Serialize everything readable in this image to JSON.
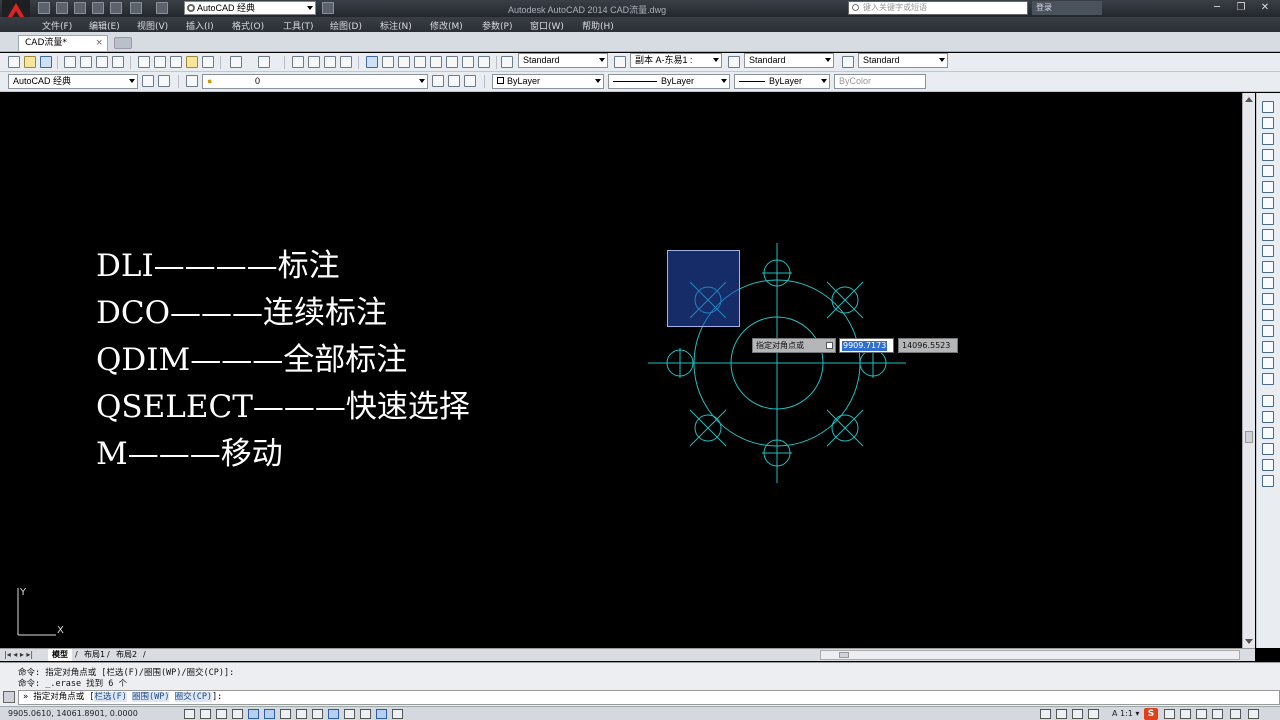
{
  "titlebar": {
    "app_title": "Autodesk AutoCAD 2014    CAD流量.dwg",
    "workspace": "AutoCAD 经典",
    "search_placeholder": "键入关键字或短语",
    "login_label": "登录",
    "minimize": "─",
    "restore": "❐",
    "close": "✕"
  },
  "menu": [
    "文件(F)",
    "编辑(E)",
    "视图(V)",
    "插入(I)",
    "格式(O)",
    "工具(T)",
    "绘图(D)",
    "标注(N)",
    "修改(M)",
    "参数(P)",
    "窗口(W)",
    "帮助(H)"
  ],
  "doc_tab": {
    "label": "CAD流量*",
    "close": "×"
  },
  "toolbar1": {
    "text_style": "Standard",
    "dim_style": "副本 A-东易1 :",
    "table_style": "Standard",
    "mleader_style": "Standard"
  },
  "toolbar2": {
    "workspace": "AutoCAD 经典",
    "layer": "0",
    "color": "ByLayer",
    "linetype": "ByLayer",
    "lineweight": "ByLayer",
    "plotstyle": "ByColor"
  },
  "canvas_text": [
    "DLI————标注",
    "DCO———连续标注",
    "QDIM———全部标注",
    "QSELECT———快速选择",
    "M———移动"
  ],
  "dynamic_input": {
    "prompt": "指定对角点或",
    "x_value": "9909.7173",
    "y_value": "14096.5523"
  },
  "ucs": {
    "x_label": "X",
    "y_label": "Y"
  },
  "layout_tabs": [
    "模型",
    "布局1",
    "布局2"
  ],
  "layout_tab_separator": "/",
  "layout_nav": "|◂ ◂ ▸ ▸|",
  "command": {
    "history": [
      "命令: 指定对角点或 [栏选(F)/圈围(WP)/圈交(CP)]:",
      "命令: _.erase 找到 6 个"
    ],
    "prompt_prefix": "» 指定对角点或 [",
    "options": [
      "栏选(F)",
      "圈围(WP)",
      "圈交(CP)"
    ],
    "prompt_suffix": "]:"
  },
  "status": {
    "coords": "9905.0610,  14061.8901,  0.0000",
    "scale": "A 1:1 ▾",
    "s_logo": "S"
  },
  "colors": {
    "drawing_lines": "#1fc0c0",
    "selection": "#2850be",
    "canvas_bg": "#000000",
    "canvas_text": "#ffffff"
  }
}
